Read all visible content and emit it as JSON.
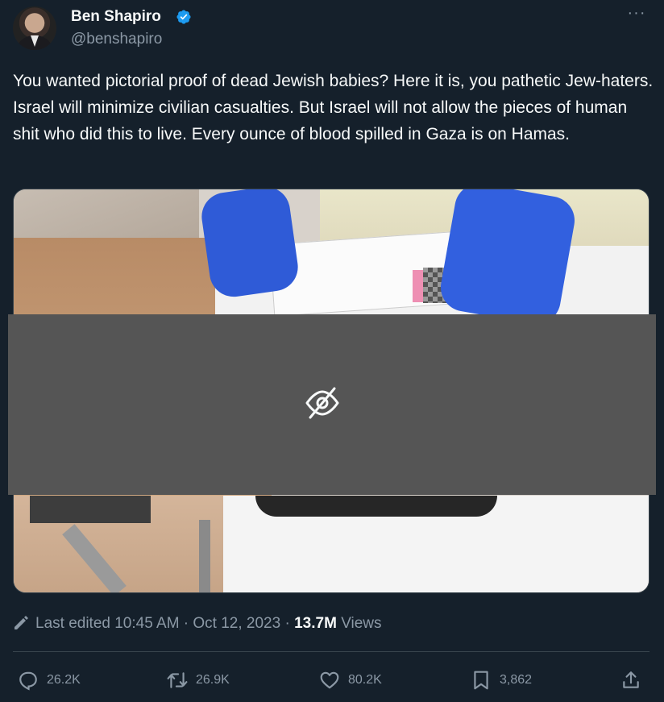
{
  "author": {
    "display_name": "Ben Shapiro",
    "handle": "@benshapiro",
    "verified": true
  },
  "tweet": {
    "text": "You wanted pictorial proof of dead Jewish babies? Here it is, you pathetic Jew-haters. Israel will minimize civilian casualties. But Israel will not allow the pieces of human shit who did this to live. Every ounce of blood spilled in Gaza is on Hamas."
  },
  "meta": {
    "edited_label": "Last edited 10:45 AM · Oct 12, 2023 ·",
    "views_count": "13.7M",
    "views_label": "Views"
  },
  "actions": {
    "replies": "26.2K",
    "retweets": "26.9K",
    "likes": "80.2K",
    "bookmarks": "3,862"
  },
  "colors": {
    "background": "#15202b",
    "text": "#f7f9f9",
    "secondary": "#8b98a5",
    "verified": "#1d9bf0",
    "overlay": "#555555"
  },
  "icons": [
    "verified-badge-icon",
    "more-icon",
    "eye-slash-icon",
    "pencil-icon",
    "reply-icon",
    "retweet-icon",
    "like-icon",
    "bookmark-icon",
    "share-icon"
  ]
}
